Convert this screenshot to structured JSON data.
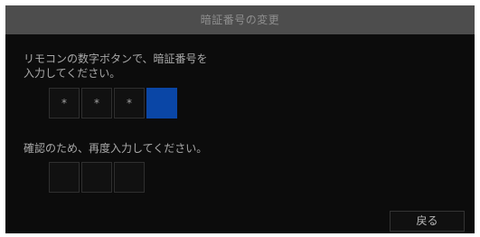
{
  "dialog": {
    "title": "暗証番号の変更",
    "prompt_line1": "リモコンの数字ボタンで、暗証番号を",
    "prompt_line2": "入力してください。",
    "entry_digits": [
      "*",
      "*",
      "*",
      ""
    ],
    "confirm_prompt": "確認のため、再度入力してください。",
    "confirm_digits": [
      "",
      "",
      ""
    ],
    "back_label": "戻る"
  },
  "colors": {
    "active_digit": "#0a46a6",
    "titlebar": "#4d4d4d",
    "background": "#0c0c0c"
  }
}
